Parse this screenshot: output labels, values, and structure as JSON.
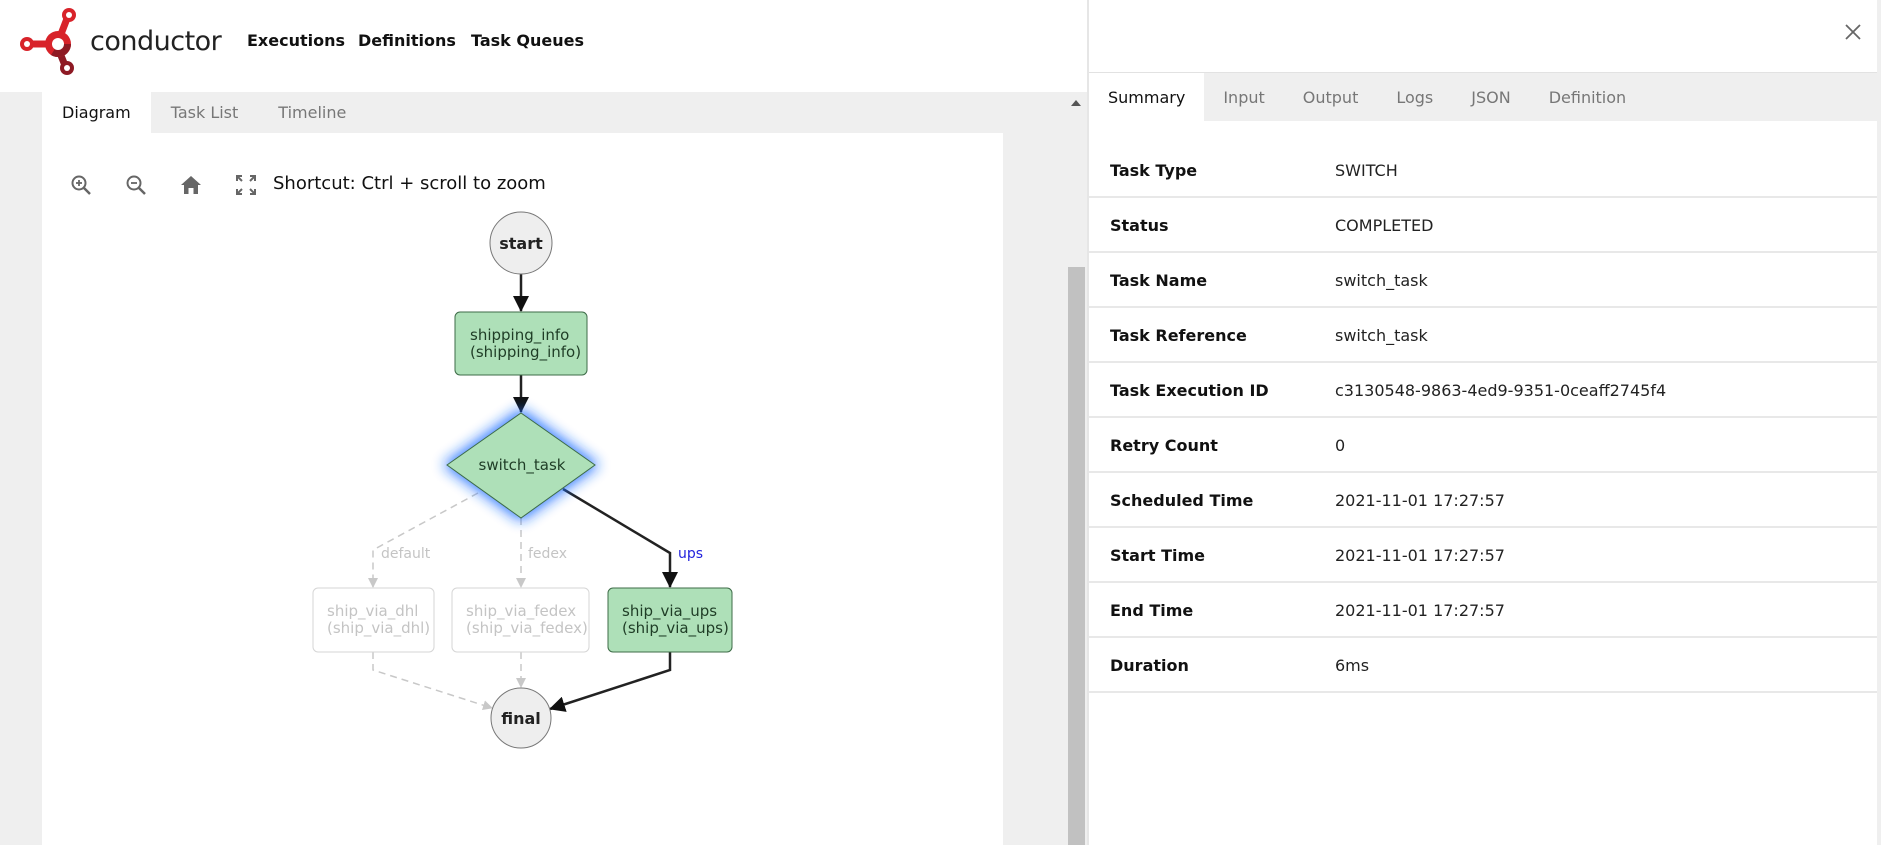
{
  "header": {
    "logo_text": "conductor",
    "nav": [
      "Executions",
      "Definitions",
      "Task Queues"
    ]
  },
  "left_tabs": [
    {
      "label": "Diagram",
      "active": true
    },
    {
      "label": "Task List",
      "active": false
    },
    {
      "label": "Timeline",
      "active": false
    }
  ],
  "toolbar": {
    "icons": [
      "zoom-in-icon",
      "zoom-out-icon",
      "home-icon",
      "fullscreen-icon"
    ],
    "shortcut_text": "Shortcut: Ctrl + scroll to zoom"
  },
  "diagram": {
    "nodes": {
      "start": {
        "label": "start",
        "kind": "terminal"
      },
      "shipping_info": {
        "line1": "shipping_info",
        "line2": "(shipping_info)",
        "status": "completed"
      },
      "switch_task": {
        "label": "switch_task",
        "kind": "decision",
        "status": "completed",
        "selected": true
      },
      "ship_via_dhl": {
        "line1": "ship_via_dhl",
        "line2": "(ship_via_dhl)",
        "status": "skipped"
      },
      "ship_via_fedex": {
        "line1": "ship_via_fedex",
        "line2": "(ship_via_fedex)",
        "status": "skipped"
      },
      "ship_via_ups": {
        "line1": "ship_via_ups",
        "line2": "(ship_via_ups)",
        "status": "completed"
      },
      "final": {
        "label": "final",
        "kind": "terminal"
      }
    },
    "edge_labels": {
      "default": "default",
      "fedex": "fedex",
      "ups": "ups"
    },
    "colors": {
      "completed_fill": "#aee0b8",
      "completed_stroke": "#3d6b47",
      "skipped_stroke": "#d0d0d0",
      "skipped_text": "#c4c4c4",
      "active_edge": "#222222",
      "inactive_edge": "#c8c8c8",
      "selected_glow": "#1a6dff",
      "ups_label": "#2222dd",
      "terminal_fill": "#eeeeee"
    }
  },
  "drawer": {
    "tabs": [
      {
        "label": "Summary",
        "active": true
      },
      {
        "label": "Input",
        "active": false
      },
      {
        "label": "Output",
        "active": false
      },
      {
        "label": "Logs",
        "active": false
      },
      {
        "label": "JSON",
        "active": false
      },
      {
        "label": "Definition",
        "active": false
      }
    ],
    "summary": [
      {
        "key": "Task Type",
        "value": "SWITCH"
      },
      {
        "key": "Status",
        "value": "COMPLETED"
      },
      {
        "key": "Task Name",
        "value": "switch_task"
      },
      {
        "key": "Task Reference",
        "value": "switch_task"
      },
      {
        "key": "Task Execution ID",
        "value": "c3130548-9863-4ed9-9351-0ceaff2745f4"
      },
      {
        "key": "Retry Count",
        "value": "0"
      },
      {
        "key": "Scheduled Time",
        "value": "2021-11-01 17:27:57"
      },
      {
        "key": "Start Time",
        "value": "2021-11-01 17:27:57"
      },
      {
        "key": "End Time",
        "value": "2021-11-01 17:27:57"
      },
      {
        "key": "Duration",
        "value": "6ms"
      }
    ]
  }
}
